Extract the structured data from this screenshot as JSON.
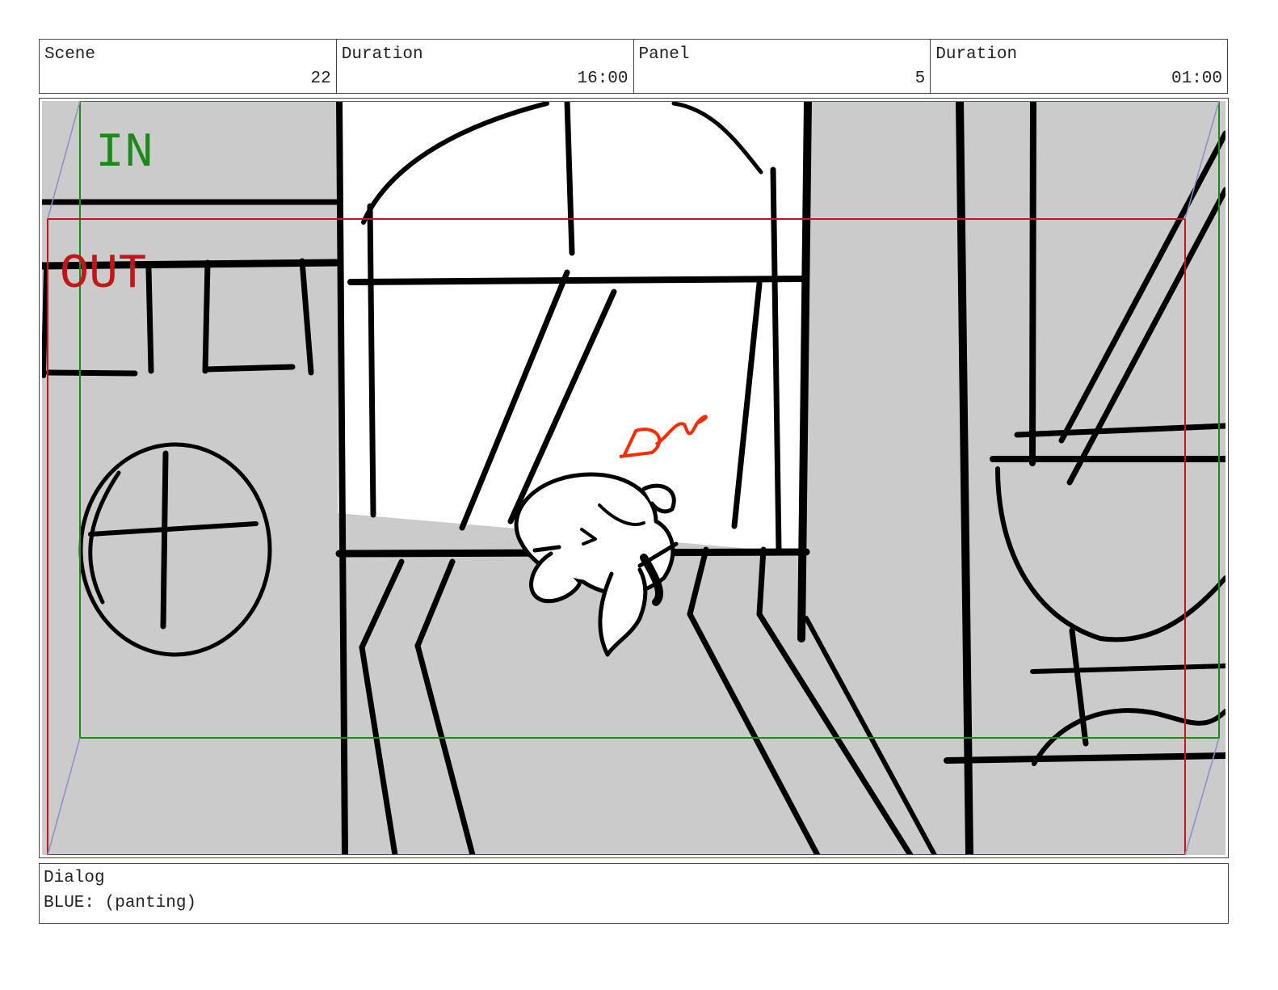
{
  "header": {
    "scene_label": "Scene",
    "scene_value": "22",
    "scene_duration_label": "Duration",
    "scene_duration_value": "16:00",
    "panel_label": "Panel",
    "panel_value": "5",
    "panel_duration_label": "Duration",
    "panel_duration_value": "01:00"
  },
  "frame": {
    "in_label": "IN",
    "out_label": "OUT",
    "in_color": "#1a8a1a",
    "out_color": "#c01818",
    "sketch_note_color": "#ff2a00"
  },
  "dialog": {
    "label": "Dialog",
    "text": "BLUE: (panting)"
  }
}
